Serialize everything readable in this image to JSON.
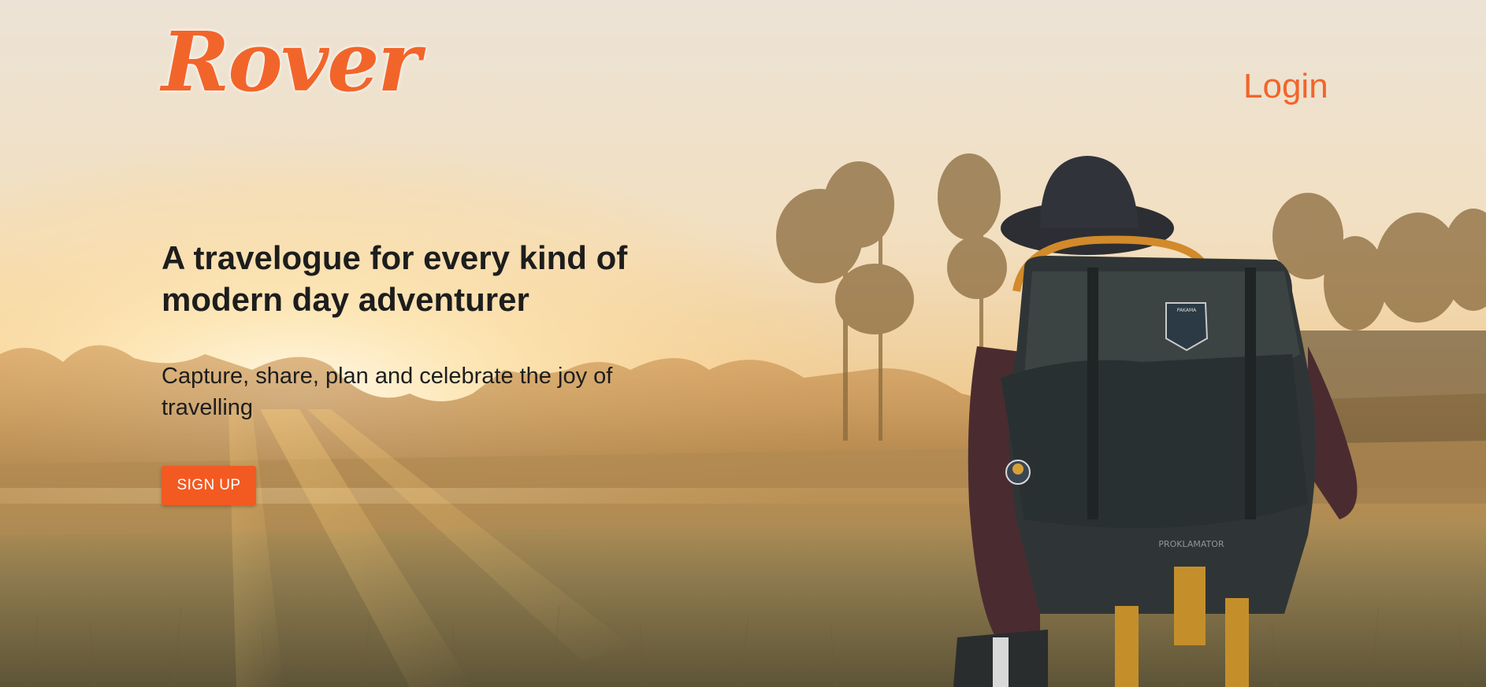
{
  "brand": {
    "logo_text": "Rover"
  },
  "nav": {
    "login_label": "Login"
  },
  "hero": {
    "headline": "A travelogue for every kind of modern day adventurer",
    "subheadline": "Capture, share, plan and celebrate the joy of travelling",
    "cta_label": "SIGN UP"
  },
  "colors": {
    "accent": "#f2652a",
    "button_bg": "#f25a22",
    "text": "#1d1d1d"
  },
  "background_image": {
    "backpack_top_label": "PAKAMA",
    "backpack_label": "PROKLAMATOR"
  }
}
